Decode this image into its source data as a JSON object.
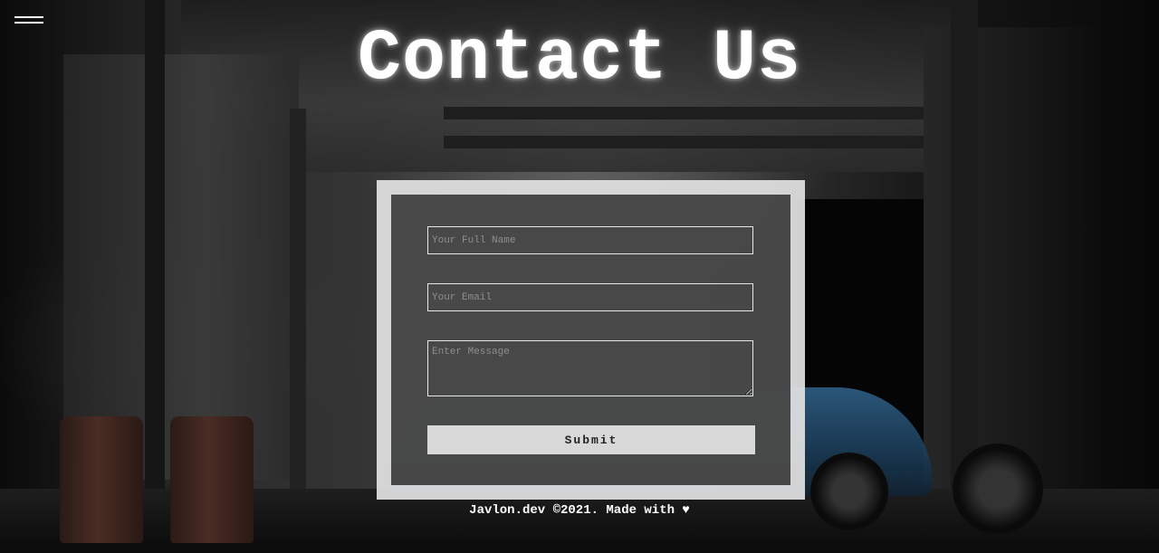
{
  "header": {
    "menu_icon": "hamburger-menu-icon",
    "title": "Contact Us"
  },
  "form": {
    "name_placeholder": "Your Full Name",
    "email_placeholder": "Your Email",
    "message_placeholder": "Enter Message",
    "submit_label": "Submit"
  },
  "footer": {
    "text": "Javlon.dev ©2021. Made with ♥"
  },
  "colors": {
    "text": "#ffffff",
    "frame": "#e1e1e1",
    "panel": "#282828"
  }
}
